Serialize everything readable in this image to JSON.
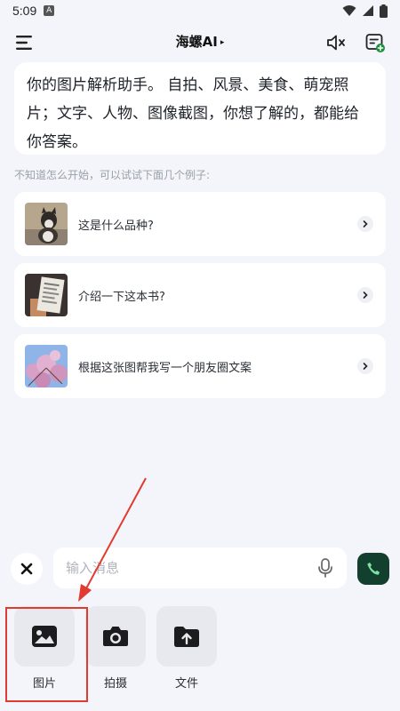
{
  "status_bar": {
    "time": "5:09",
    "notification_badge": "A"
  },
  "header": {
    "title": "海螺AI",
    "caret": "▸"
  },
  "intro": {
    "text": "你的图片解析助手。 自拍、风景、美食、萌宠照片；文字、人物、图像截图，你想了解的，都能给你答案。"
  },
  "hint": "不知道怎么开始，可以试试下面几个例子:",
  "examples": [
    {
      "label": "这是什么品种?",
      "thumb": "cat-photo"
    },
    {
      "label": "介绍一下这本书?",
      "thumb": "book-photo"
    },
    {
      "label": "根据这张图帮我写一个朋友圈文案",
      "thumb": "blossom-photo"
    }
  ],
  "input": {
    "placeholder": "输入消息",
    "value": ""
  },
  "tools": [
    {
      "label": "图片",
      "icon": "image-icon"
    },
    {
      "label": "拍摄",
      "icon": "camera-icon"
    },
    {
      "label": "文件",
      "icon": "upload-file-icon"
    }
  ],
  "colors": {
    "background": "#f3f5fa",
    "call_button": "#123f2e",
    "annotation_red": "#e23a2e",
    "new_chat_badge": "#1e8f3e"
  }
}
